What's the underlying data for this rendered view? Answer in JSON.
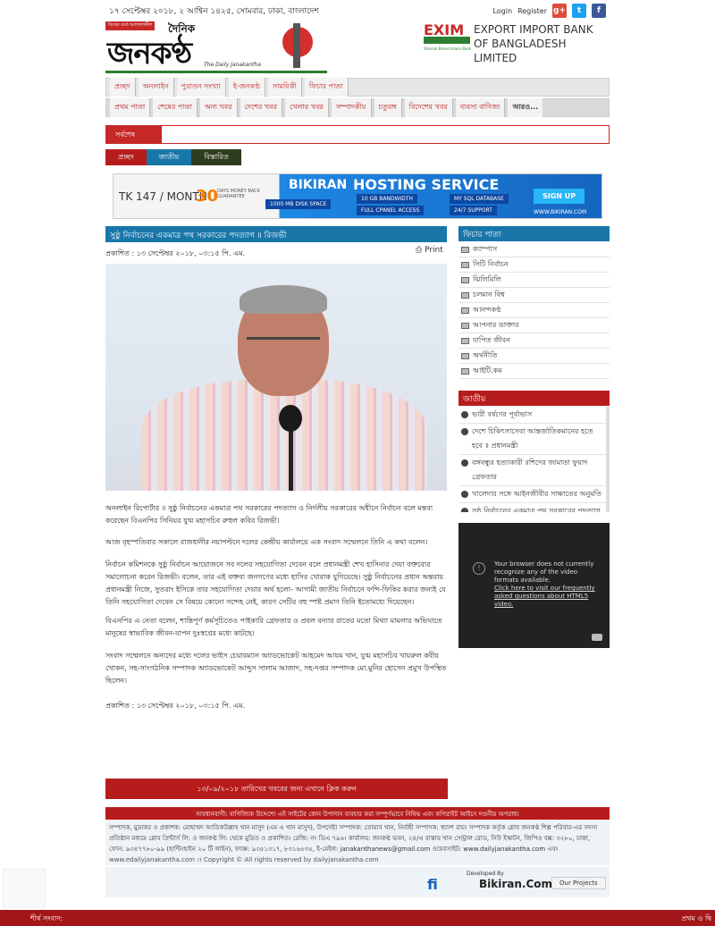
{
  "topbar": {
    "date": "১৭ সেপ্টেম্বর ২০১৮, ২ আশ্বিন ১৪২৫, সোমবার, ঢাকা, বাংলাদেশ",
    "login": "Login",
    "register": "Register"
  },
  "logo": {
    "tagline": "বিবেক বর্তে আন্দোলনীল",
    "dainik": "দৈনিক",
    "name": "জনকণ্ঠ",
    "english": "The Daily Janakantha"
  },
  "bank": {
    "brand": "EXIM",
    "small": "Shariah Based Islami Bank",
    "line1": "EXPORT IMPORT BANK",
    "line2": "OF BANGLADESH LIMITED"
  },
  "nav1": [
    "প্রচ্ছদ",
    "অনলাইন",
    "পুরাতন সংখ্যা",
    "ই-জনকণ্ঠ",
    "সাময়িকী",
    "ফিচার পাতা"
  ],
  "nav2": [
    "প্রথম পাতা",
    "শেষের পাতা",
    "অন্য খবর",
    "দেশের খবর",
    "খেলার খবর",
    "সম্পাদকীয়",
    "চতুরঙ্গ",
    "বিদেশের খবর",
    "ব্যবসা বাণিজ্য",
    "আরও..."
  ],
  "latest_label": "সর্বশেষ",
  "breadcrumb": [
    "প্রচ্ছদ",
    "জাতীয়",
    "বিস্তারিত"
  ],
  "ad": {
    "tk": "TK 147 / MONTH",
    "days": "30",
    "days_text": "DAYS MONEY BACK GUARANTEE",
    "brand": "BIKIRAN",
    "title": "HOSTING SERVICE",
    "disk": "1000 MB DISK SPACE",
    "f1": "10 GB BANDWIDTH",
    "f2": "FULL CPANEL ACCESS",
    "f3": "MY SQL DATABASE",
    "f4": "24/7 SUPPORT",
    "signup": "SIGN UP",
    "url": "WWW.BIKIRAN.COM"
  },
  "article": {
    "title": "সুষ্ঠু নির্বাচনের একমাত্র পথ সরকারের পদত্যাগ ॥ রিজভী",
    "published": "প্রকাশিত : ১৩ সেপ্টেম্বর ২০১৮, ০৩:১৫ পি. এম.",
    "print": "Print",
    "p1": "অনলাইন রিপোর্টার ॥ সুষ্ঠু নির্বাচনের একমাত্র পথ সরকারের পদত্যাগ ও নির্দলীয় সরকারের অধীনে নির্বাচন বলে মন্তব্য করেছেন বিএনপির সিনিয়র যুগ্ম মহাসচিব রুহুল কবির রিজভী।",
    "p2": "আজ বৃহস্পতিবার সকালে রাজধানীর নয়াপল্টনে দলের কেন্দ্রীয় কার্যালয়ে এক সংবাদ সম্মেলনে তিনি এ কথা বলেন।",
    "p3": "নির্বাচন কমিশনকে সুষ্ঠু নির্বাচন আয়োজনে সব দলের সহযোগিতা দেবেন বলে প্রধানমন্ত্রী শেখ হাসিনার দেয়া বক্তব্যের সমালোচনা করেন রিজভী। বলেন, তার এই বক্তব্য জনগণের মধ্যে হাসির খোরাক যুগিয়েছে। সুষ্ঠু নির্বাচনের প্রধান অন্তরায় প্রধানমন্ত্রী নিজে, সুতরাং ইসিকে তার সহযোগিতা দেয়ার অর্থ হলো- আগামী জাতীয় নির্বাচনে ফন্দি-ফিকির করার জন্যই যে তিনি সহযোগিতা দেবেন সে বিষয়ে কোনো সন্দেহ নেই, কারণ সেটির বহু স্পষ্ট প্রমাণ তিনি ইতোমধ্যে দিয়েছেন।",
    "p4": "বিএনপির এ নেতা বলেন, শান্তিপূর্ণ কর্মসূচিতেও পাইকারি গ্রেফতার ও প্রবল বন্যার রাতের মতো মিথ্যা মামলার অভিঘাতে মানুষের স্বাভাবিক জীবন-যাপন দুঃস্বপ্নের মধ্যে কাটছে।",
    "p5": "সংবাদ সম্মেলনে অন্যদের মধ্যে দলের ভাইস চেয়ারম্যান অ্যাডভোকেট আহমেদ আযম খান, যুগ্ম মহাসচিব খায়রুল কবীর খোকন, সহ-সাংগঠনিক সম্পাদক অ্যাডভোকেট আব্দুস সালাম আজাদ, সহ-দপ্তর সম্পাদক মো.মুনির হোসেন প্রমুখ উপস্থিত ছিলেন।",
    "published2": "প্রকাশিত : ১৩ সেপ্টেম্বর ২০১৮, ০৩:১৫ পি. এম.",
    "click_bar": "১৩/০৯/২০১৮ তারিখের খবরের জন্য এখানে ক্লিক করুন"
  },
  "sidebar": {
    "feature_title": "ফিচার পাতা",
    "feature_items": [
      "ক্যাম্পাস",
      "সিটি নির্বাচন",
      "ঝিলিমিলি",
      "চলমান বিশ্ব",
      "আনন্দকণ্ঠ",
      "আপনার ডাক্তার",
      "যাপিত জীবন",
      "অর্থনীতি",
      "আইটি.কম"
    ],
    "national_title": "জাতীয়",
    "national_items": [
      "ভারী বর্ষণের পূর্বাভাস",
      "দেশে চিকিৎসাসেবা আন্তর্জাতিকমানের হতে হবে ॥ প্রধানমন্ত্রী",
      "বঙ্গবন্ধুর হত্যাকারী রশিদের জামাতা ফুয়াদ গ্রেফতার",
      "খালেদার সঙ্গে আইনজীবীর সাক্ষাতের অনুমতি",
      "সুষ্ঠু নির্বাচনের একমাত্র পথ সরকারের পদত্যাগ"
    ],
    "video_msg": "Your browser does not currently recognize any of the video formats available.",
    "video_link": "Click here to visit our frequently asked questions about HTML5 video."
  },
  "footer": {
    "warning": "সাবধানবাণী: বাণিজ্যিক উদ্দেশ্যে এই সাইটের কোন উপাদান ব্যবহার করা সম্পূর্ণভাবে নিষিদ্ধ এবং কপিরাইট আইনে দণ্ডনীয় অপরাধ।",
    "info": "সম্পাদক, মুদ্রাকর ও প্রকাশক: মোহাম্মদ আতিকউল্লাহ খান মাসুদ (এম এ খান মাসুদ), উপদেষ্টা সম্পাদক: তোয়াব খান, নির্বাহী সম্পাদক: স্বদেশ রায়। সম্পাদক কর্তৃক গ্লোব জনকণ্ঠ শিল্প পরিবার-এর সদস্য প্রতিষ্ঠান মধ্যমে গ্লোব প্রিন্টার্স লি: ও জনকণ্ঠ লি: থেকে মুদ্রিত ও প্রকাশিত। রেজি: নং ডিএ ৭৯৬। কার্যালয়: জনকণ্ঠ ভবন, ২৪/এ রাস্তায় খান সেন্ট্রাল রোড, নিউ ইস্কাটন, জিপিও বক্স: ৩২৮০, ঢাকা, ফোন: ৯৩৪৭৭৮০-৯৯ (হান্টিংহাইন ২০ টি লাইন), ফ্যাক্স: ৯৩৫১৩১৭, ৮৩১৬৫৩৫, ই-মেইল: janakanthanews@gmail.com ওয়েবসাইট: www.dailyjanakantha.com এবং",
    "copy": "www.edailyjanakantha.com ।। Copyright © All rights reserved by dailyjanakantha.com",
    "developed": "Developed By",
    "dev_name": "Bikiran.Com",
    "projects": "Our Projects"
  },
  "ticker": {
    "left": "শীর্ষ সংবাদ:",
    "right": "প্রথম ও দ্বি"
  }
}
